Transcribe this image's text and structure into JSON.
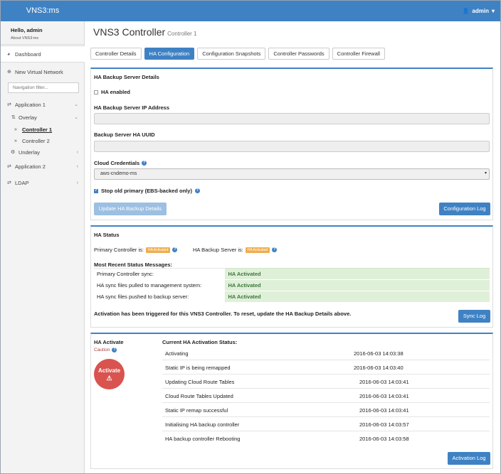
{
  "app": {
    "brand": "VNS3:ms",
    "user": "admin"
  },
  "sidebar": {
    "hello": "Hello, admin",
    "about": "About VNS3:ms",
    "dashboard": "Dashboard",
    "new_vn": "New Virtual Network",
    "filter_placeholder": "Navigation filter...",
    "items": [
      {
        "label": "Application 1"
      },
      {
        "label": "Overlay"
      },
      {
        "label": "Controller 1"
      },
      {
        "label": "Controller 2"
      },
      {
        "label": "Underlay"
      },
      {
        "label": "Application 2"
      },
      {
        "label": "LDAP"
      }
    ]
  },
  "header": {
    "title": "VNS3 Controller",
    "subtitle": "Controller 1"
  },
  "tabs": [
    {
      "label": "Controller Details"
    },
    {
      "label": "HA Configuration"
    },
    {
      "label": "Configuration Snapshots"
    },
    {
      "label": "Controller Passwords"
    },
    {
      "label": "Controller Firewall"
    }
  ],
  "backup": {
    "title": "HA Backup Server Details",
    "ha_enabled": "HA enabled",
    "ip_label": "HA Backup Server IP Address",
    "uuid_label": "Backup Server HA UUID",
    "cred_label": "Cloud Credentials",
    "cred_value": "aws-cndemo-ms",
    "stop_old": "Stop old primary (EBS-backed only)",
    "update_btn": "Update HA Backup Details",
    "config_log_btn": "Configuration Log"
  },
  "status": {
    "title": "HA Status",
    "primary_label": "Primary Controller is:",
    "primary_badge": "HA Activated",
    "backup_label": "HA Backup Server is:",
    "backup_badge": "HA Activated",
    "recent_title": "Most Recent Status Messages:",
    "rows": [
      {
        "label": "Primary Controller sync:",
        "value": "HA Activated"
      },
      {
        "label": "HA sync files pulled to management system:",
        "value": "HA Activated"
      },
      {
        "label": "HA sync files pushed to backup server:",
        "value": "HA Activated"
      }
    ],
    "note": "Activation has been triggered for this VNS3 Controller. To reset, update the HA Backup Details above.",
    "sync_log_btn": "Sync Log"
  },
  "activate": {
    "title": "HA Activate",
    "caution": "Caution",
    "button": "Activate",
    "current_title": "Current HA Activation Status:",
    "rows": [
      {
        "msg": "Activating",
        "time": "2016-06-03 14:03:38"
      },
      {
        "msg": "Static IP is being remapped",
        "time": "2016-06-03 14:03:40"
      },
      {
        "msg": "Updating Cloud Route Tables",
        "time": "2016-06-03 14:03:41"
      },
      {
        "msg": "Cloud Route Tables Updated",
        "time": "2016-06-03 14:03:41"
      },
      {
        "msg": "Static IP remap successful",
        "time": "2016-06-03 14:03:41"
      },
      {
        "msg": "Initialising HA backup controller",
        "time": "2016-06-03 14:03:57"
      },
      {
        "msg": "HA backup controller Rebooting",
        "time": "2016-06-03 14:03:58"
      }
    ],
    "log_btn": "Activation Log"
  }
}
